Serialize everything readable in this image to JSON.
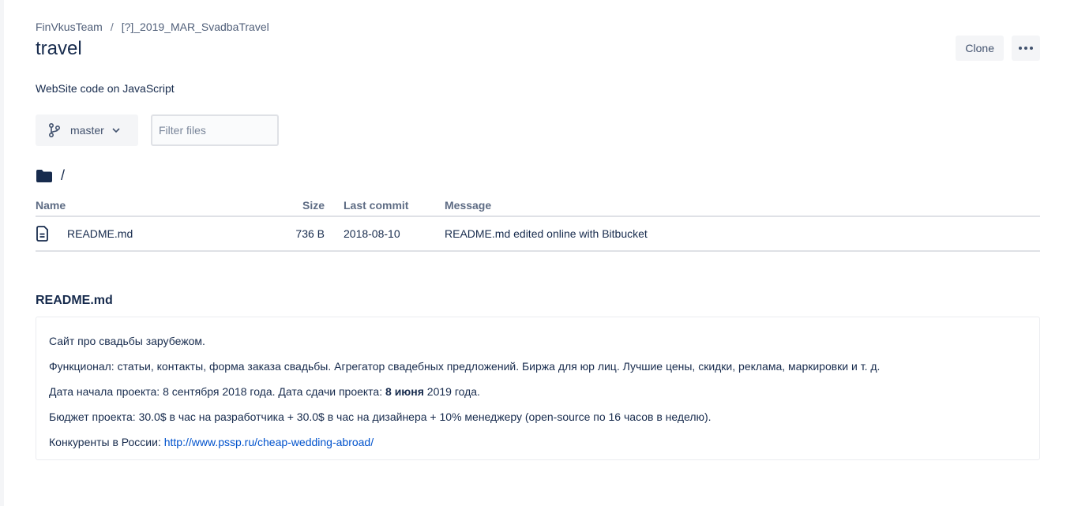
{
  "breadcrumb": {
    "team": "FinVkusTeam",
    "separator": "/",
    "project": "[?]_2019_MAR_SvadbaTravel"
  },
  "repo": {
    "title": "travel",
    "description": "WebSite code on JavaScript"
  },
  "actions": {
    "clone_label": "Clone",
    "more_icon": "more-horizontal-icon"
  },
  "branch": {
    "icon": "branch-icon",
    "label": "master",
    "chevron_icon": "chevron-down-icon"
  },
  "filter": {
    "placeholder": "Filter files",
    "value": ""
  },
  "path": {
    "icon": "folder-icon",
    "current": "/"
  },
  "files_table": {
    "headers": {
      "name": "Name",
      "size": "Size",
      "last_commit": "Last commit",
      "message": "Message"
    },
    "rows": [
      {
        "icon": "file-icon",
        "name": "README.md",
        "size": "736 B",
        "last_commit": "2018-08-10",
        "message": "README.md edited online with Bitbucket"
      }
    ]
  },
  "readme": {
    "title": "README.md",
    "line1": "Сайт про свадьбы зарубежом.",
    "line2": "Функционал: статьи, контакты, форма заказа свадьбы. Агрегатор свадебных предложений. Биржа для юр лиц. Лучшие цены, скидки, реклама, маркировки и т. д.",
    "line3_prefix": "Дата начала проекта: 8 сентября 2018 года. Дата сдачи проекта: ",
    "line3_bold": "8 июня",
    "line3_suffix": " 2019 года.",
    "line4": "Бюджет проекта: 30.0$ в час на разработчика + 30.0$ в час на дизайнера + 10% менеджеру (open-source по 16 часов в неделю).",
    "line5_prefix": "Конкуренты в России: ",
    "line5_link": "http://www.pssp.ru/cheap-wedding-abroad/"
  },
  "colors": {
    "text": "#172b4d",
    "link": "#0052cc",
    "muted": "#5e6c84",
    "border": "#dfe1e6",
    "button_bg": "#f4f5f7"
  }
}
